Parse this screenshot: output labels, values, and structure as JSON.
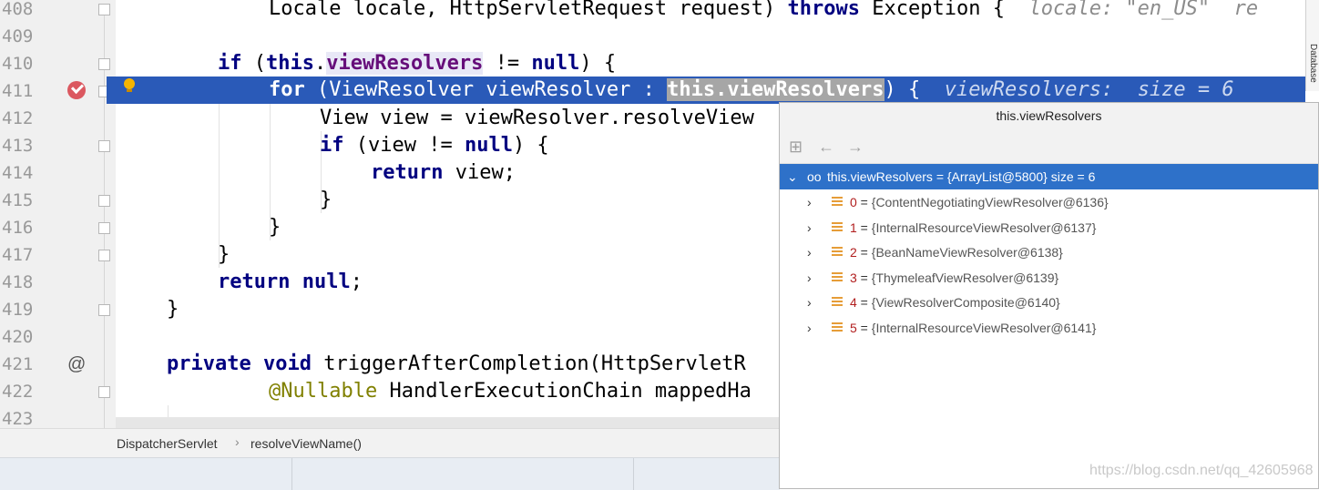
{
  "editor": {
    "line_numbers": [
      "408",
      "409",
      "410",
      "411",
      "412",
      "413",
      "414",
      "415",
      "416",
      "417",
      "418",
      "419",
      "420",
      "421",
      "422",
      "423"
    ],
    "lines": {
      "l408_a": "Locale locale, HttpServletRequest request) ",
      "l408_kw": "throws",
      "l408_b": " Exception {  ",
      "l408_hint": "locale: \"en_US\"  re",
      "l410_kw": "if",
      "l410_a": " (",
      "l410_this": "this",
      "l410_dot": ".",
      "l410_fld": "viewResolvers",
      "l410_b": " != ",
      "l410_null": "null",
      "l410_c": ") {",
      "l411_kw": "for",
      "l411_a": " (ViewResolver viewResolver : ",
      "l411_sel": "this.viewResolvers",
      "l411_b": ") {  ",
      "l411_hint": "viewResolvers:  size = 6",
      "l412": "View view = viewResolver.resolveView",
      "l413_kw": "if",
      "l413_a": " (view != ",
      "l413_null": "null",
      "l413_b": ") {",
      "l414_kw": "return",
      "l414_a": " view;",
      "l415": "}",
      "l416": "}",
      "l417": "}",
      "l418_kw": "return",
      "l418_null": "null",
      "l418_a": ";",
      "l419": "}",
      "l421_kw": "private void",
      "l421_a": " triggerAfterCompletion(HttpServletR",
      "l422_ann": "@Nullable",
      "l422_a": " HandlerExecutionChain mappedHa"
    },
    "gutter_at": "@",
    "sidebar_label": "Database"
  },
  "breadcrumb": {
    "items": [
      "DispatcherServlet",
      "resolveViewName()"
    ],
    "separator": "›"
  },
  "popup": {
    "title": "this.viewResolvers",
    "root": {
      "label": "this.viewResolvers = {ArrayList@5800}  size = 6"
    },
    "items": [
      {
        "index": "0",
        "eq": " = ",
        "value": "{ContentNegotiatingViewResolver@6136}"
      },
      {
        "index": "1",
        "eq": " = ",
        "value": "{InternalResourceViewResolver@6137}"
      },
      {
        "index": "2",
        "eq": " = ",
        "value": "{BeanNameViewResolver@6138}"
      },
      {
        "index": "3",
        "eq": " = ",
        "value": "{ThymeleafViewResolver@6139}"
      },
      {
        "index": "4",
        "eq": " = ",
        "value": "{ViewResolverComposite@6140}"
      },
      {
        "index": "5",
        "eq": " = ",
        "value": "{InternalResourceViewResolver@6141}"
      }
    ],
    "toolbar": {
      "tree_icon": "⊞",
      "back_icon": "←",
      "forward_icon": "→"
    },
    "expand_glyph": "›",
    "collapse_glyph": "⌄",
    "watch_glyph": "oo"
  },
  "watermark": "https://blog.csdn.net/qq_42605968",
  "colors": {
    "selection_row": "#2a5ab8",
    "tree_selection": "#2e71c9",
    "keyword": "#000080",
    "field": "#660e7a"
  }
}
